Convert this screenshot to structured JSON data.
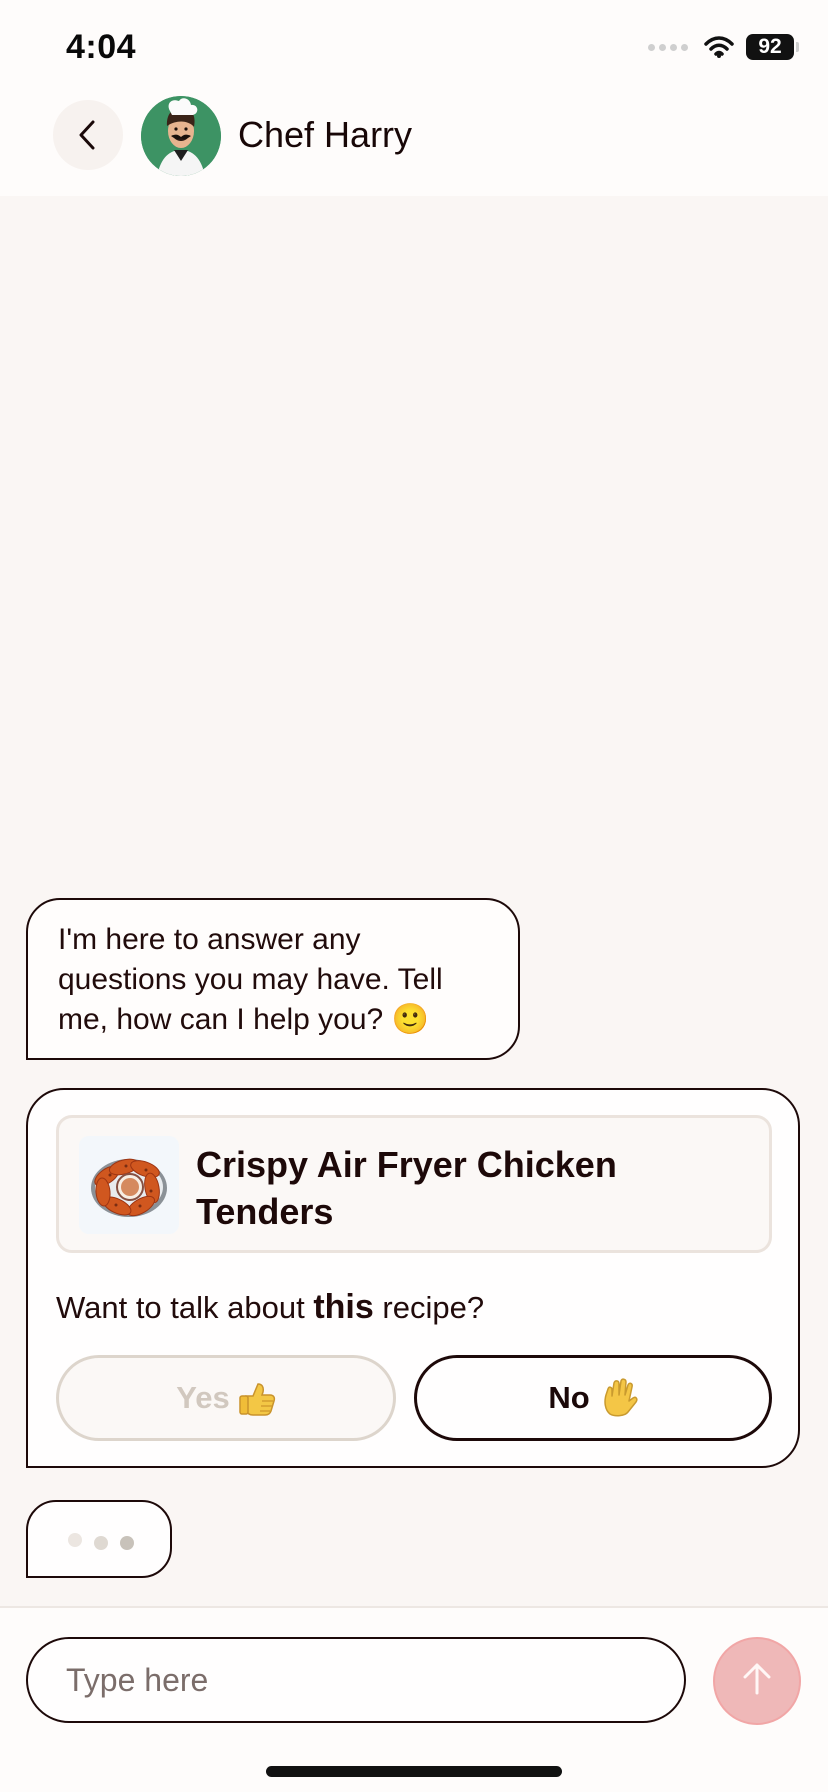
{
  "status_bar": {
    "time": "4:04",
    "battery_level": "92",
    "signal_icon": "cellular-signal-icon",
    "wifi_icon": "wifi-icon",
    "battery_icon": "battery-icon"
  },
  "header": {
    "back_icon": "chevron-left-icon",
    "avatar_icon": "chef-avatar-icon",
    "title": "Chef Harry"
  },
  "chat": {
    "assistant_message": "I'm here to answer any questions you may have. Tell me, how can I help you? 🙂",
    "recipe_prompt": {
      "thumbnail_icon": "chicken-tenders-thumbnail",
      "recipe_title": "Crispy Air Fryer Chicken Tenders",
      "question_before": "Want to talk about ",
      "question_emphasis": "this",
      "question_after": " recipe?",
      "yes_label": "Yes",
      "yes_icon": "thumbs-up-icon",
      "no_label": "No",
      "no_icon": "raised-hand-icon"
    },
    "typing_indicator_icon": "typing-dots-icon"
  },
  "composer": {
    "input_value": "",
    "input_placeholder": "Type here",
    "send_icon": "arrow-up-icon"
  },
  "colors": {
    "background": "#faf6f4",
    "header_background": "#fefcfb",
    "text": "#1f0b0b",
    "border": "#1d0909",
    "avatar_green": "#3d9364",
    "disabled_border": "#ddd5cc",
    "send_button": "#efb8b8"
  }
}
